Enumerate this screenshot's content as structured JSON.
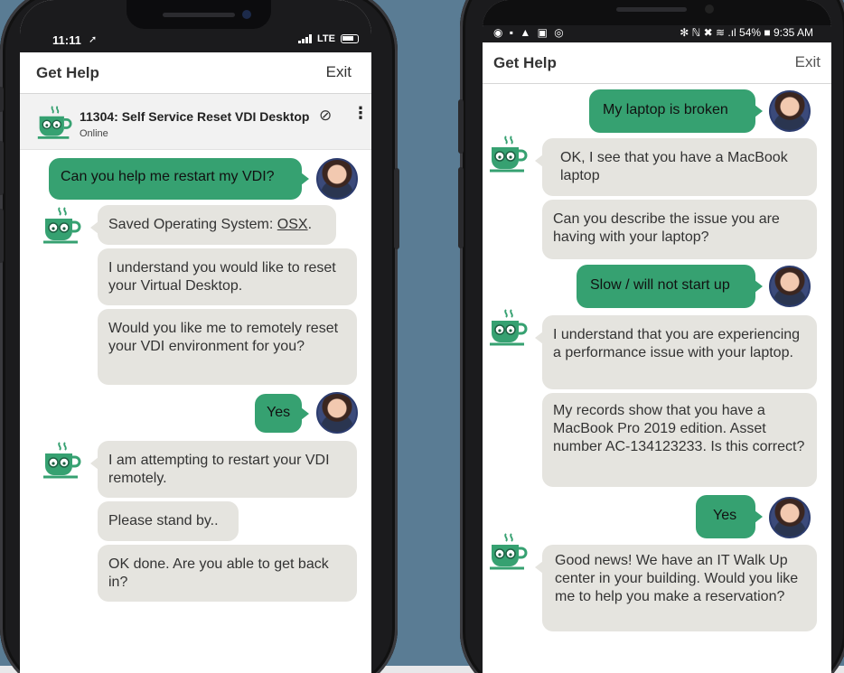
{
  "colors": {
    "accent_green": "#36a171",
    "bot_bubble": "#e5e4df",
    "background": "#5a7c94"
  },
  "left_phone": {
    "status": {
      "time": "11:11",
      "network": "LTE"
    },
    "appbar": {
      "title": "Get Help",
      "exit": "Exit"
    },
    "ticket": {
      "title": "11304: Self Service Reset VDI Desktop",
      "status": "Online",
      "attach_icon": "paperclip-icon",
      "menu_icon": "more-vertical-icon"
    },
    "messages": [
      {
        "from": "user",
        "text": "Can you help me restart my VDI?"
      },
      {
        "from": "bot",
        "text_prefix": "Saved Operating System: ",
        "link": "OSX",
        "suffix": "."
      },
      {
        "from": "bot",
        "text": "I understand you would like to reset your Virtual Desktop."
      },
      {
        "from": "bot",
        "text": "Would you like me to remotely reset your VDI environment for you?"
      },
      {
        "from": "user",
        "text": "Yes"
      },
      {
        "from": "bot",
        "text": "I am attempting to restart your VDI remotely."
      },
      {
        "from": "bot",
        "text": "Please stand by.."
      },
      {
        "from": "bot",
        "text": "OK done. Are you able to get back in?"
      }
    ]
  },
  "right_phone": {
    "status": {
      "left_icons": "◉ ▪ ▲ ▣ ◎",
      "right": "✻ ℕ ✖ ≋ .ıl 54% ■ 9:35 AM"
    },
    "appbar": {
      "title": "Get Help",
      "exit": "Exit"
    },
    "messages": [
      {
        "from": "user",
        "text": "My laptop is broken"
      },
      {
        "from": "bot",
        "text": "OK, I see that you have a MacBook laptop"
      },
      {
        "from": "bot",
        "text": "Can you describe the issue you are having with your laptop?"
      },
      {
        "from": "user",
        "text": "Slow / will not start up"
      },
      {
        "from": "bot",
        "text": "I understand that you are experiencing a performance issue with your laptop."
      },
      {
        "from": "bot",
        "text": "My records show that you have a MacBook Pro 2019 edition. Asset number AC-134123233. Is this correct?"
      },
      {
        "from": "user",
        "text": "Yes"
      },
      {
        "from": "bot",
        "text": "Good news! We have an IT Walk Up center in your building. Would you like me to help you make a reservation?"
      }
    ]
  }
}
